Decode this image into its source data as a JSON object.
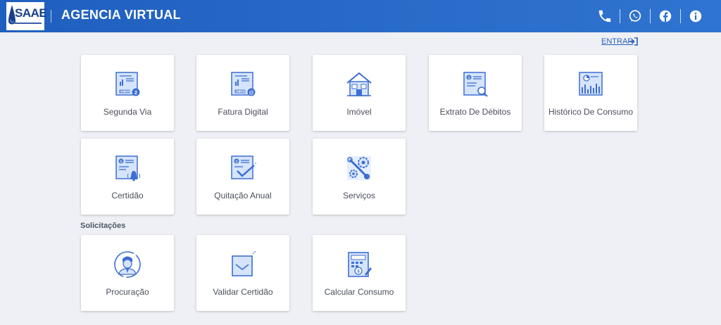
{
  "header": {
    "logo_text": "SAAE",
    "title": "AGENCIA VIRTUAL",
    "icons": [
      "phone-icon",
      "whatsapp-icon",
      "facebook-icon",
      "info-icon"
    ]
  },
  "login": {
    "label": "ENTRAR"
  },
  "services": [
    {
      "label": "Segunda Via",
      "icon": "invoice-copy-icon"
    },
    {
      "label": "Fatura Digital",
      "icon": "digital-invoice-icon"
    },
    {
      "label": "Imóvel",
      "icon": "house-icon"
    },
    {
      "label": "Extrato De Débitos",
      "icon": "debt-statement-icon"
    },
    {
      "label": "Histórico De Consumo",
      "icon": "consumption-history-icon"
    },
    {
      "label": "Certidão",
      "icon": "certificate-icon"
    },
    {
      "label": "Quitação Anual",
      "icon": "annual-discharge-icon"
    },
    {
      "label": "Serviços",
      "icon": "services-icon"
    }
  ],
  "requests": {
    "title": "Solicitações",
    "items": [
      {
        "label": "Procuração",
        "icon": "power-of-attorney-icon"
      },
      {
        "label": "Validar Certidão",
        "icon": "validate-certificate-icon"
      },
      {
        "label": "Calcular Consumo",
        "icon": "calculator-icon"
      }
    ]
  },
  "colors": {
    "header": "#2a6cc9",
    "background": "#eef0f5",
    "icon_blue": "#3d6fd1",
    "icon_fill": "#d6e4fb"
  }
}
